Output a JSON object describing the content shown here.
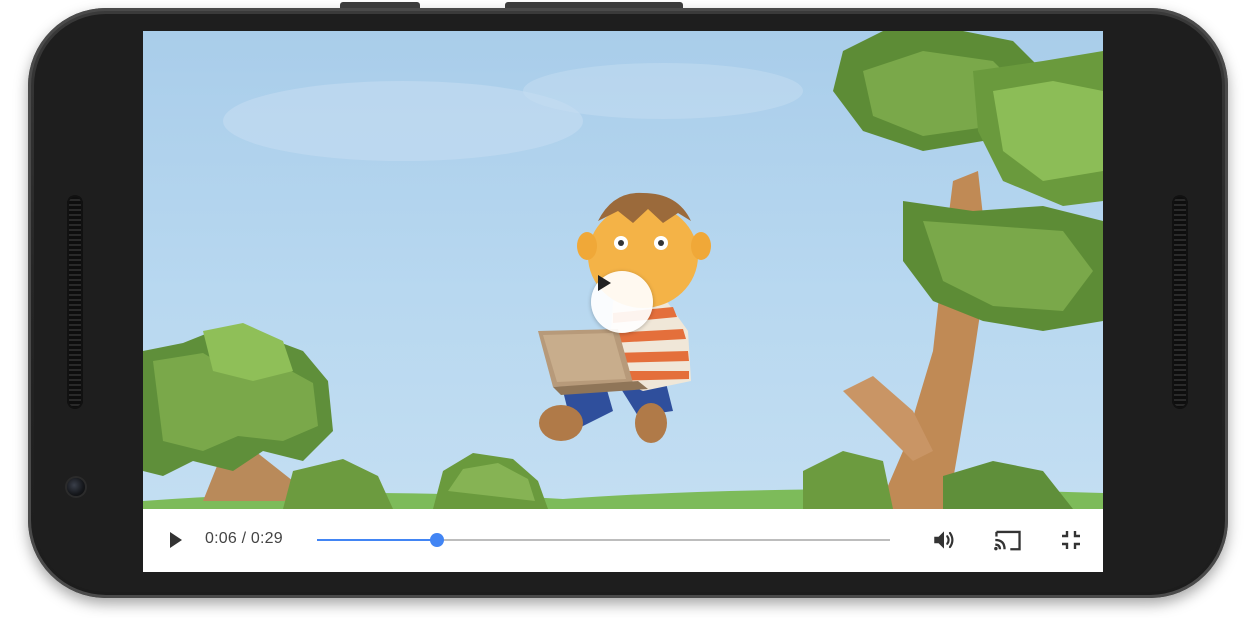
{
  "player": {
    "current_time": "0:06",
    "separator": "/",
    "duration": "0:29",
    "progress_fraction": 0.21,
    "accent_color": "#4285f4",
    "track_color": "#bdbdbd"
  },
  "controls": {
    "play_icon": "play-icon",
    "volume_icon": "volume-icon",
    "cast_icon": "cast-icon",
    "exit_fullscreen_icon": "exit-fullscreen-icon",
    "overlay_play_icon": "play-icon"
  }
}
